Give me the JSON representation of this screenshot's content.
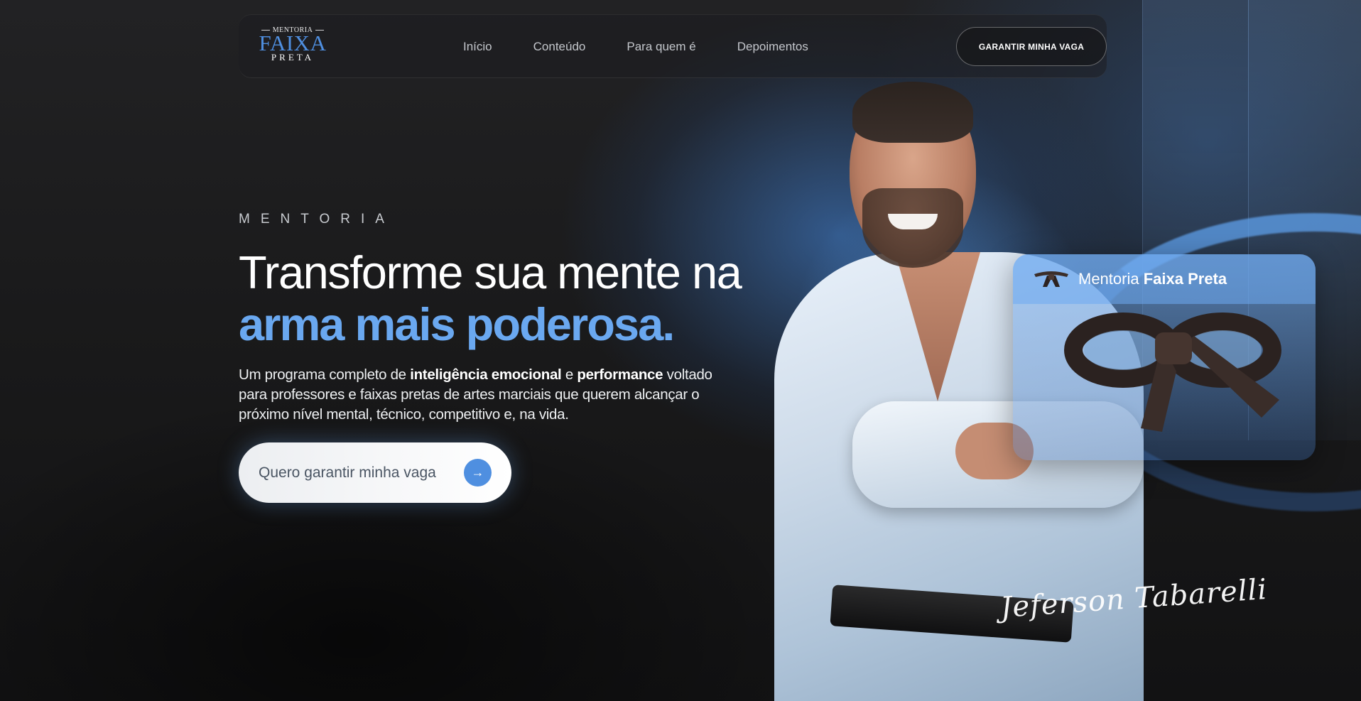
{
  "nav": {
    "logo": {
      "top": "MENTORIA",
      "main": "FAIXA",
      "bottom": "PRETA"
    },
    "links": [
      "Início",
      "Conteúdo",
      "Para quem é",
      "Depoimentos"
    ],
    "cta_label": "GARANTIR MINHA VAGA"
  },
  "hero": {
    "eyebrow": "MENTORIA",
    "headline_line1": "Transforme sua mente na",
    "headline_line2": "arma mais poderosa.",
    "description": {
      "p1": "Um programa completo de ",
      "b1": "inteligência emocional",
      "p2": " e ",
      "b2": "performance",
      "p3": " voltado para professores e faixas pretas de artes marciais que querem alcançar o próximo nível mental, técnico, competitivo e, na vida."
    },
    "cta_label": "Quero garantir minha vaga",
    "cta_icon": "arrow-right-icon"
  },
  "card": {
    "title_regular": "Mentoria ",
    "title_bold": "Faixa Preta",
    "icon": "belt-icon"
  },
  "signature": "Jeferson Tabarelli",
  "colors": {
    "accent": "#4f8fe0",
    "headline_accent": "#6aa8f0",
    "background": "#1b1b1c"
  }
}
